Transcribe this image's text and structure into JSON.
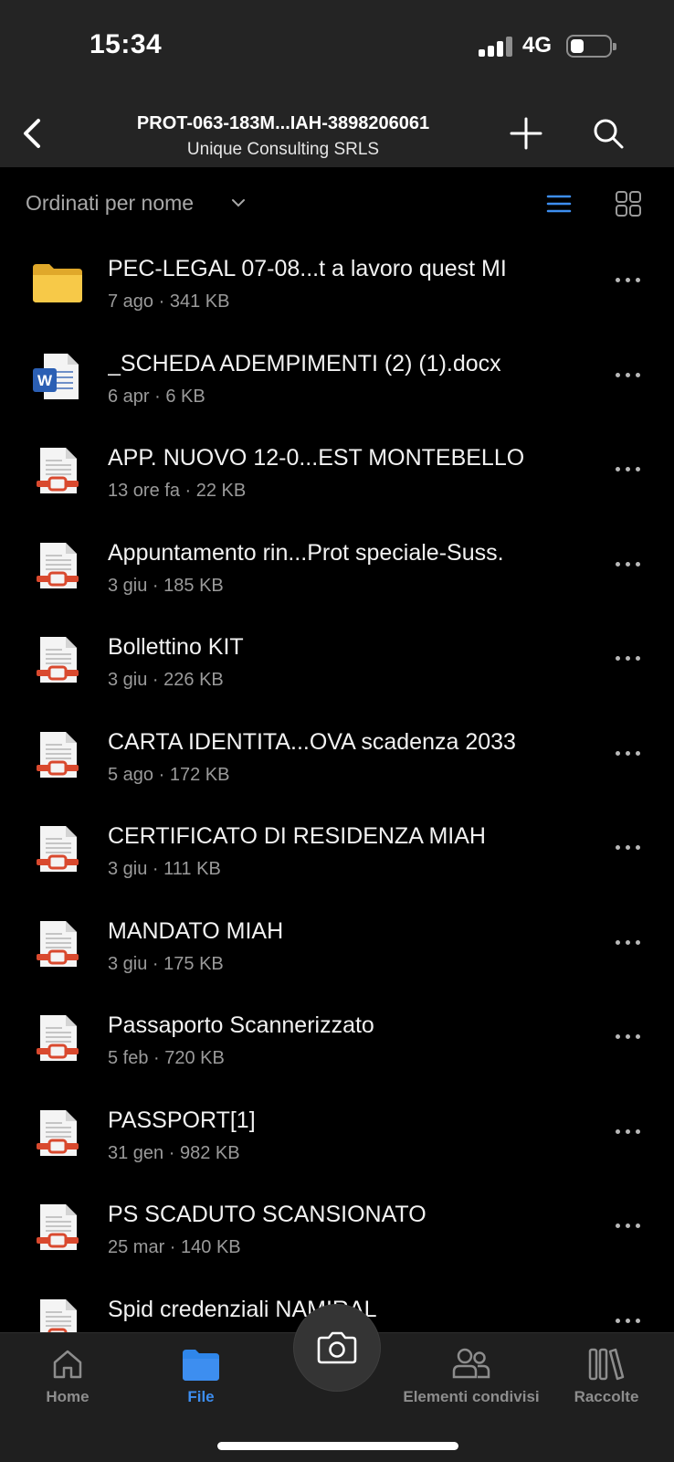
{
  "status": {
    "time": "15:34",
    "network": "4G"
  },
  "header": {
    "title": "PROT-063-183M...IAH-3898206061",
    "subtitle": "Unique Consulting SRLS"
  },
  "sort": {
    "label": "Ordinati per nome"
  },
  "files": [
    {
      "name": "PEC-LEGAL 07-08...t a lavoro quest MI",
      "meta": "7 ago · 341 KB",
      "type": "folder"
    },
    {
      "name": "_SCHEDA ADEMPIMENTI (2) (1).docx",
      "meta": "6 apr · 6 KB",
      "type": "word"
    },
    {
      "name": "APP. NUOVO 12-0...EST MONTEBELLO",
      "meta": "13 ore fa · 22 KB",
      "type": "pdf"
    },
    {
      "name": "Appuntamento rin...Prot speciale-Suss.",
      "meta": "3 giu · 185 KB",
      "type": "pdf"
    },
    {
      "name": "Bollettino KIT",
      "meta": "3 giu · 226 KB",
      "type": "pdf"
    },
    {
      "name": "CARTA IDENTITA...OVA scadenza 2033",
      "meta": "5 ago · 172 KB",
      "type": "pdf"
    },
    {
      "name": "CERTIFICATO DI RESIDENZA MIAH",
      "meta": "3 giu · 111 KB",
      "type": "pdf"
    },
    {
      "name": "MANDATO MIAH",
      "meta": "3 giu · 175 KB",
      "type": "pdf"
    },
    {
      "name": "Passaporto Scannerizzato",
      "meta": "5 feb · 720 KB",
      "type": "pdf"
    },
    {
      "name": "PASSPORT[1]",
      "meta": "31 gen · 982 KB",
      "type": "pdf"
    },
    {
      "name": "PS SCADUTO SCANSIONATO",
      "meta": "25 mar · 140 KB",
      "type": "pdf"
    },
    {
      "name": "Spid credenziali NAMIRAL",
      "meta": "",
      "type": "pdf"
    }
  ],
  "tabs": [
    {
      "label": "Home",
      "icon": "home-icon"
    },
    {
      "label": "File",
      "icon": "folder-icon"
    },
    {
      "label": "Elementi condivisi",
      "icon": "people-icon"
    },
    {
      "label": "Raccolte",
      "icon": "library-icon"
    }
  ],
  "colors": {
    "accent": "#3d8ef0",
    "folder": "#f7c948",
    "word": "#2b5fb4",
    "pdf": "#d9492e"
  }
}
